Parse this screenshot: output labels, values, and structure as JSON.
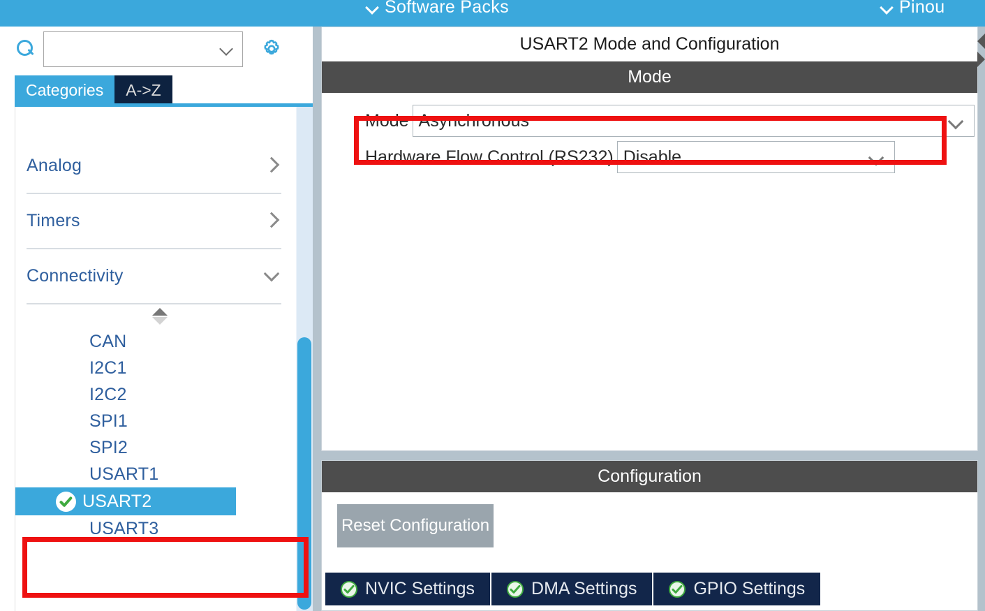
{
  "top_bar": {
    "items": [
      {
        "label": "Software Packs",
        "icon": "chevron-down-icon"
      },
      {
        "label": "Pinou",
        "icon": "chevron-down-icon"
      }
    ]
  },
  "sidebar": {
    "search": {
      "value": "",
      "placeholder": "",
      "icon": "search-icon",
      "dropdown_icon": "chevron-down-icon"
    },
    "settings_icon": "gear-icon",
    "tabs": [
      {
        "label": "Categories",
        "active": true
      },
      {
        "label": "A->Z",
        "active": false
      }
    ],
    "categories": [
      {
        "label": "Analog",
        "expanded": false,
        "icon": "chevron-right-icon"
      },
      {
        "label": "Timers",
        "expanded": false,
        "icon": "chevron-right-icon"
      },
      {
        "label": "Connectivity",
        "expanded": true,
        "icon": "chevron-down-icon"
      }
    ],
    "sort_indicator": "sort-updown-icon",
    "peripherals": [
      {
        "label": "CAN",
        "selected": false,
        "configured": false
      },
      {
        "label": "I2C1",
        "selected": false,
        "configured": false
      },
      {
        "label": "I2C2",
        "selected": false,
        "configured": false
      },
      {
        "label": "SPI1",
        "selected": false,
        "configured": false
      },
      {
        "label": "SPI2",
        "selected": false,
        "configured": false
      },
      {
        "label": "USART1",
        "selected": false,
        "configured": false
      },
      {
        "label": "USART2",
        "selected": true,
        "configured": true,
        "status_icon": "check-circle-icon"
      },
      {
        "label": "USART3",
        "selected": false,
        "configured": false
      }
    ]
  },
  "main": {
    "panel_title": "USART2 Mode and Configuration",
    "mode_section": {
      "heading": "Mode",
      "fields": [
        {
          "label": "Mode",
          "value": "Asynchronous",
          "icon": "chevron-down-icon",
          "highlighted": true
        },
        {
          "label": "Hardware Flow Control (RS232)",
          "value": "Disable",
          "icon": "chevron-down-icon",
          "highlighted": false
        }
      ]
    },
    "config_section": {
      "heading": "Configuration",
      "reset_button": "Reset Configuration",
      "tabs": [
        {
          "label": "NVIC Settings",
          "status_icon": "check-circle-icon"
        },
        {
          "label": "DMA Settings",
          "status_icon": "check-circle-icon"
        },
        {
          "label": "GPIO Settings",
          "status_icon": "check-circle-icon"
        }
      ]
    }
  },
  "colors": {
    "accent_blue": "#3ba8dc",
    "navy": "#12264a",
    "band_gray": "#4d4d4d",
    "highlight_red": "#ee1111",
    "check_green": "#3faa3f",
    "splitter": "#b4c2cc"
  }
}
